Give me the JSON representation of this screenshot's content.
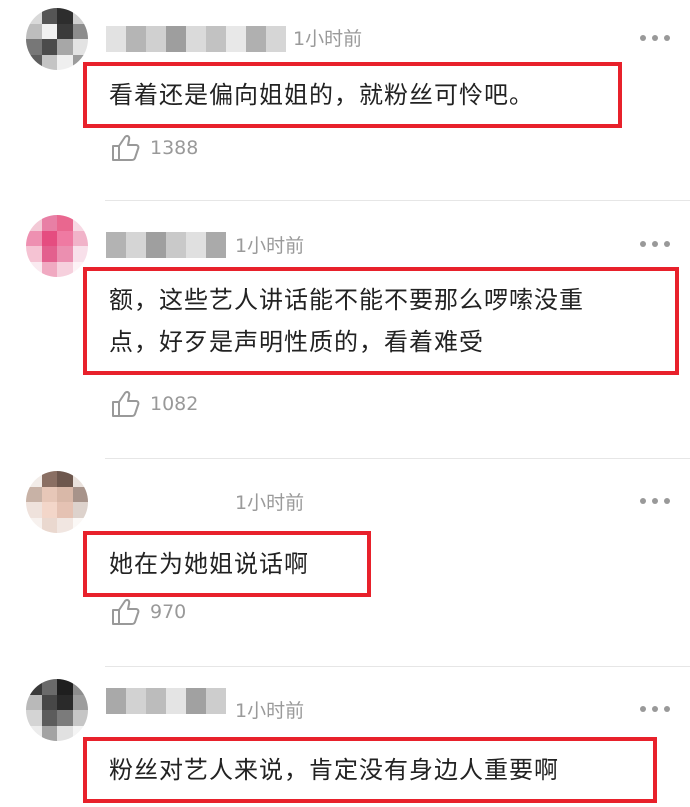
{
  "colors": {
    "highlight_border": "#e8212b",
    "meta_text": "#9a9a9a",
    "divider": "#e6e6e6"
  },
  "comments": [
    {
      "time": "1小时前",
      "content_lines": [
        "看着还是偏向姐姐的，就粉丝可怜吧。"
      ],
      "likes": "1388",
      "like_icon": "thumbs-up-icon",
      "more_icon": "more-icon"
    },
    {
      "time": "1小时前",
      "content_lines": [
        "额，这些艺人讲话能不能不要那么啰嗦没重",
        "点，好歹是声明性质的，看着难受"
      ],
      "likes": "1082",
      "like_icon": "thumbs-up-icon",
      "more_icon": "more-icon"
    },
    {
      "time": "1小时前",
      "content_lines": [
        "她在为她姐说话啊"
      ],
      "likes": "970",
      "like_icon": "thumbs-up-icon",
      "more_icon": "more-icon"
    },
    {
      "time": "1小时前",
      "content_lines": [
        "粉丝对艺人来说，肯定没有身边人重要啊"
      ],
      "likes": "",
      "like_icon": "thumbs-up-icon",
      "more_icon": "more-icon"
    }
  ]
}
